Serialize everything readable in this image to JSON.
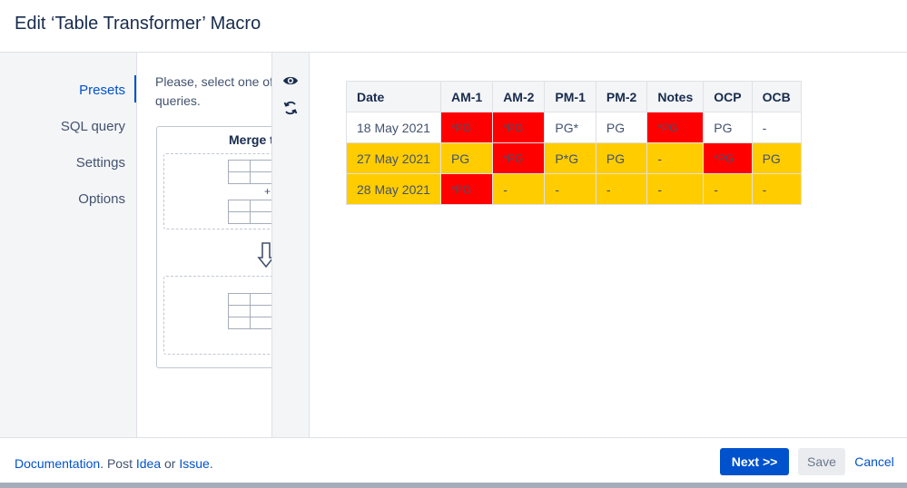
{
  "dialog": {
    "title": "Edit ‘Table Transformer’ Macro"
  },
  "sidebar": {
    "items": [
      {
        "label": "Presets",
        "active": true
      },
      {
        "label": "SQL query",
        "active": false
      },
      {
        "label": "Settings",
        "active": false
      },
      {
        "label": "Options",
        "active": false
      }
    ]
  },
  "presets": {
    "intro_line1": "Please, select one of",
    "intro_line2": "queries.",
    "card_title": "Merge t",
    "plus": "+"
  },
  "toolstrip": {
    "icons": [
      "eye-icon",
      "refresh-icon"
    ]
  },
  "preview_table": {
    "headers": [
      "Date",
      "AM-1",
      "AM-2",
      "PM-1",
      "PM-2",
      "Notes",
      "OCP",
      "OCB"
    ],
    "rows": [
      {
        "cells": [
          {
            "v": "18 May 2021",
            "c": "white"
          },
          {
            "v": "*PG",
            "c": "red"
          },
          {
            "v": "*PG",
            "c": "red"
          },
          {
            "v": "PG*",
            "c": "white"
          },
          {
            "v": "PG",
            "c": "white"
          },
          {
            "v": "*PG",
            "c": "red"
          },
          {
            "v": "PG",
            "c": "white"
          },
          {
            "v": "-",
            "c": "white"
          }
        ]
      },
      {
        "cells": [
          {
            "v": "27 May 2021",
            "c": "yellow"
          },
          {
            "v": "PG",
            "c": "yellow"
          },
          {
            "v": "*PG",
            "c": "red"
          },
          {
            "v": "P*G",
            "c": "yellow"
          },
          {
            "v": "PG",
            "c": "yellow"
          },
          {
            "v": "-",
            "c": "yellow"
          },
          {
            "v": "*PG",
            "c": "red"
          },
          {
            "v": "PG",
            "c": "yellow"
          }
        ]
      },
      {
        "cells": [
          {
            "v": "28 May 2021",
            "c": "yellow"
          },
          {
            "v": "*PG",
            "c": "red"
          },
          {
            "v": "-",
            "c": "yellow"
          },
          {
            "v": "-",
            "c": "yellow"
          },
          {
            "v": "-",
            "c": "yellow"
          },
          {
            "v": "-",
            "c": "yellow"
          },
          {
            "v": "-",
            "c": "yellow"
          },
          {
            "v": "-",
            "c": "yellow"
          }
        ]
      }
    ]
  },
  "footer": {
    "documentation": "Documentation",
    "sep1": ". Post ",
    "idea": "Idea",
    "sep2": " or ",
    "issue": "Issue",
    "sep3": ".",
    "next_label": "Next >>",
    "save_label": "Save",
    "cancel_label": "Cancel"
  },
  "colors": {
    "accent": "#0052cc",
    "cell_red": "#ff0000",
    "cell_yellow": "#ffcc00"
  }
}
